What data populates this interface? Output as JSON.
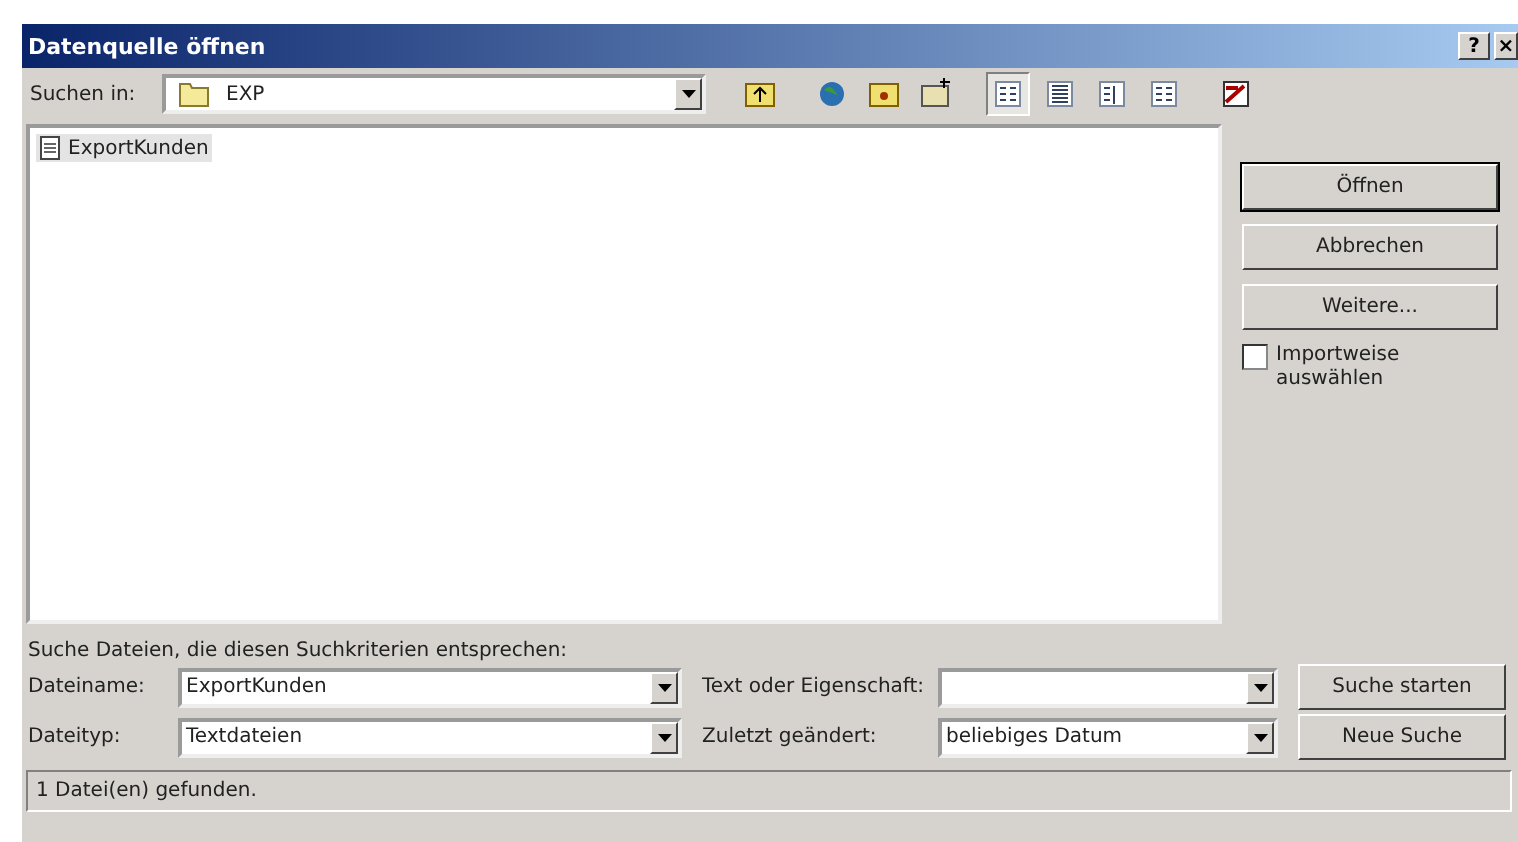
{
  "window": {
    "title": "Datenquelle öffnen",
    "help_button": "?",
    "close_button": "×"
  },
  "look_in": {
    "label": "Suchen in:",
    "value": "EXP"
  },
  "toolbar": [
    {
      "kind": "up",
      "selected": false
    },
    {
      "kind": "web",
      "selected": false
    },
    {
      "kind": "newfolder",
      "selected": false
    },
    {
      "kind": "addfolder",
      "selected": false
    },
    {
      "kind": "list",
      "selected": true
    },
    {
      "kind": "details",
      "selected": false
    },
    {
      "kind": "properties",
      "selected": false
    },
    {
      "kind": "preview",
      "selected": false
    },
    {
      "kind": "tools",
      "selected": false
    }
  ],
  "files": [
    {
      "name": "ExportKunden",
      "selected": true
    }
  ],
  "side_buttons": [
    {
      "label": "Öffnen",
      "default": true
    },
    {
      "label": "Abbrechen",
      "default": false
    },
    {
      "label": "Weitere...",
      "default": false
    }
  ],
  "import_checkbox": {
    "label": "Importweise auswählen",
    "checked": false
  },
  "search": {
    "caption": "Suche Dateien, die diesen Suchkriterien entsprechen:",
    "rows": [
      {
        "label": "Dateiname:",
        "value": "ExportKunden",
        "label2": "Text oder Eigenschaft:",
        "button": "Suche starten"
      },
      {
        "label": "Dateityp:",
        "value": "Textdateien",
        "label2": "Zuletzt geändert:",
        "value2": "beliebiges Datum",
        "button": "Neue Suche"
      }
    ]
  },
  "status_bar": "1 Datei(en) gefunden."
}
